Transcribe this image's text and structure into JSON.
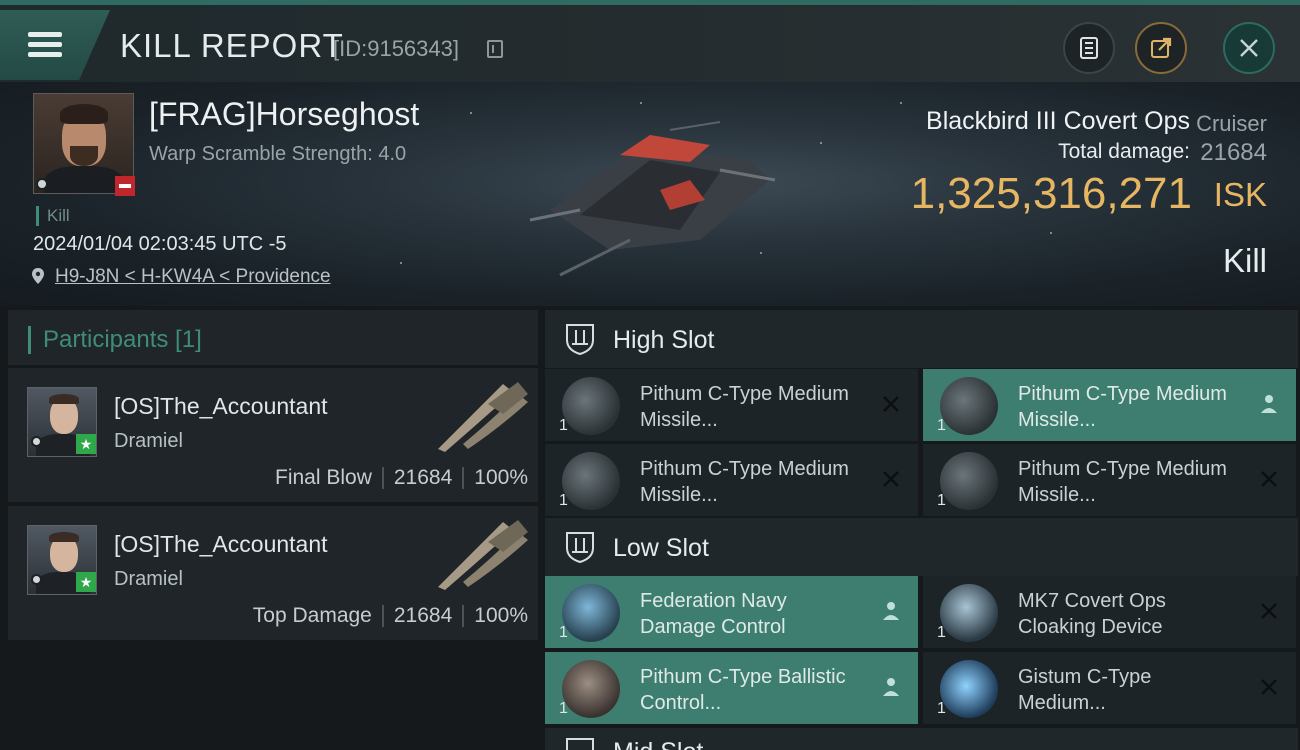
{
  "header": {
    "title": "KILL REPORT",
    "report_id": "[ID:9156343]",
    "buttons": [
      "notes-icon",
      "share-icon",
      "close-icon"
    ]
  },
  "victim": {
    "name": "[FRAG]Horseghost",
    "warp_scramble": "Warp Scramble Strength: 4.0",
    "kill_tag": "Kill",
    "datetime": "2024/01/04 02:03:45 UTC -5",
    "location": "H9-J8N < H-KW4A < Providence",
    "ship_name": "Blackbird III Covert Ops",
    "ship_class": "Cruiser",
    "total_damage_label": "Total damage:",
    "total_damage": "21684",
    "isk_value": "1,325,316,271",
    "isk_unit": "ISK",
    "result": "Kill"
  },
  "participants": {
    "title": "Participants [1]",
    "items": [
      {
        "name": "[OS]The_Accountant",
        "ship": "Dramiel",
        "role": "Final Blow",
        "damage": "21684",
        "percent": "100%"
      },
      {
        "name": "[OS]The_Accountant",
        "ship": "Dramiel",
        "role": "Top Damage",
        "damage": "21684",
        "percent": "100%"
      }
    ]
  },
  "slots": {
    "high": {
      "label": "High Slot",
      "modules": [
        {
          "name": "Pithum C-Type Medium Missile...",
          "qty": "1",
          "status": "destroyed"
        },
        {
          "name": "Pithum C-Type Medium Missile...",
          "qty": "1",
          "status": "dropped"
        },
        {
          "name": "Pithum C-Type Medium Missile...",
          "qty": "1",
          "status": "destroyed"
        },
        {
          "name": "Pithum C-Type Medium Missile...",
          "qty": "1",
          "status": "destroyed"
        }
      ]
    },
    "low": {
      "label": "Low Slot",
      "modules": [
        {
          "name": "Federation Navy Damage Control",
          "qty": "1",
          "status": "dropped"
        },
        {
          "name": "MK7 Covert Ops Cloaking Device",
          "qty": "1",
          "status": "destroyed"
        },
        {
          "name": "Pithum C-Type Ballistic Control...",
          "qty": "1",
          "status": "dropped"
        },
        {
          "name": "Gistum C-Type Medium...",
          "qty": "1",
          "status": "destroyed"
        }
      ]
    },
    "mid": {
      "label": "Mid Slot"
    }
  },
  "colors": {
    "accent": "#3f8c7a",
    "isk": "#e6b662",
    "dropped_bg": "#3e7e70",
    "destroyed_bg": "#1d2427"
  }
}
